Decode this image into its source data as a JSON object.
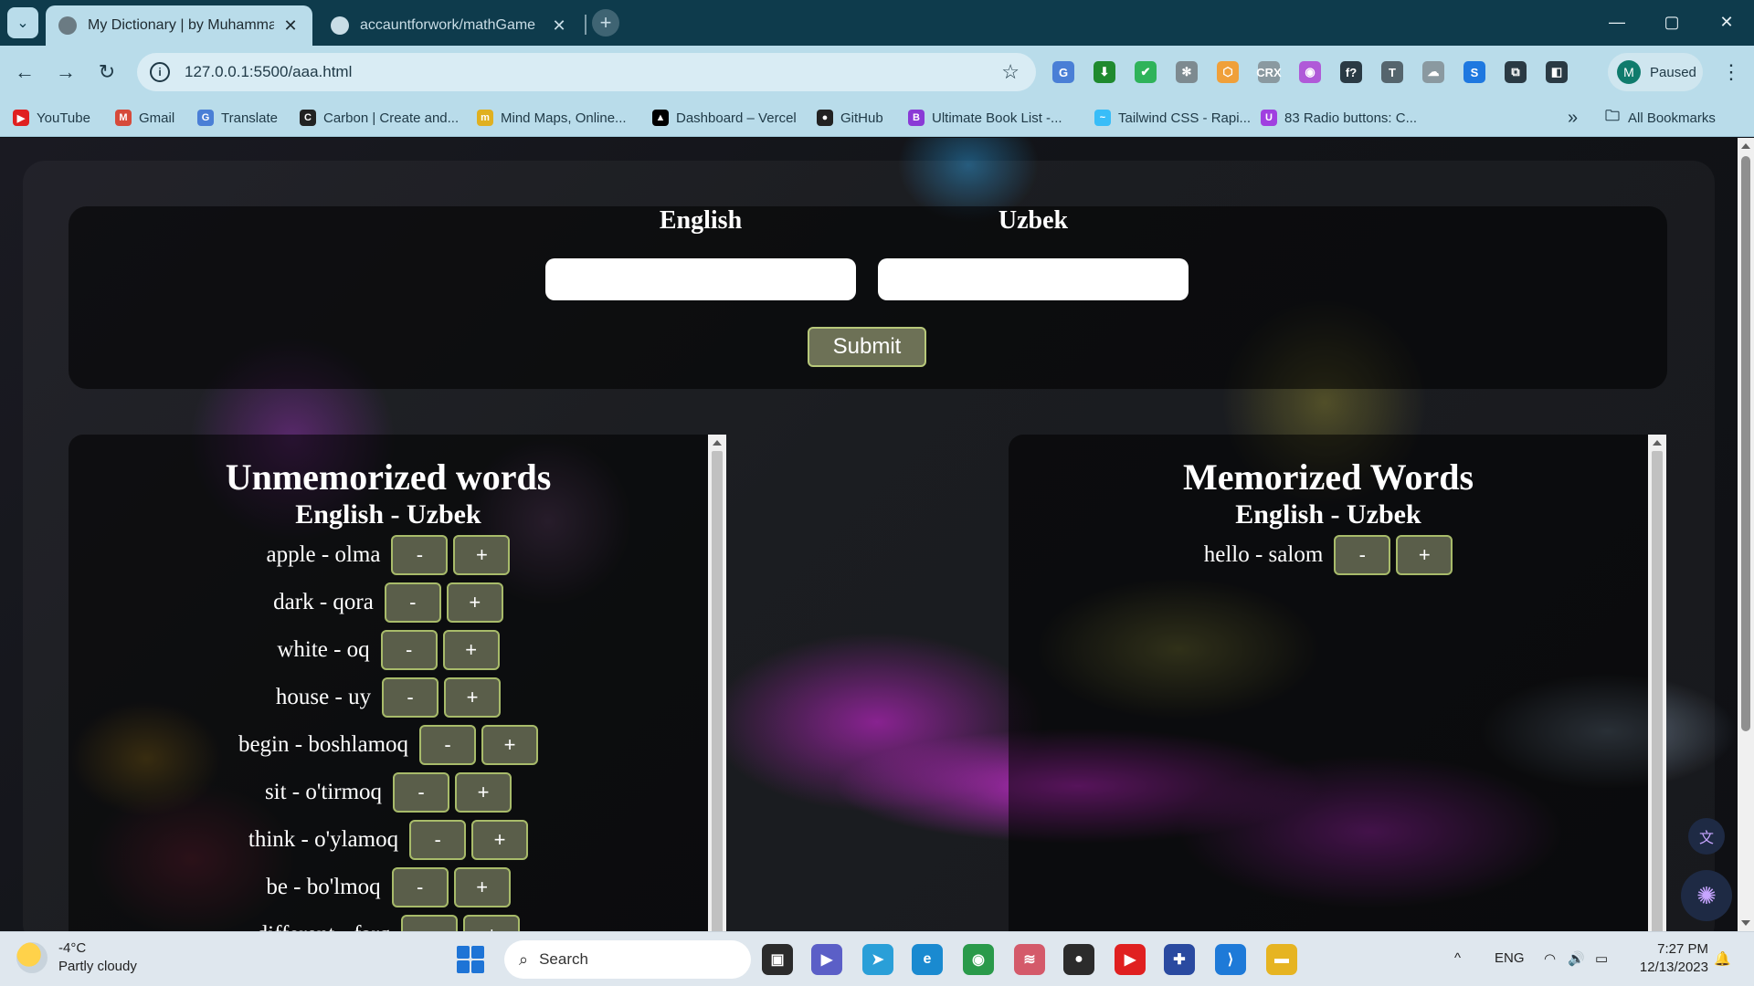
{
  "browser": {
    "tabs": [
      {
        "title": "My Dictionary | by Muhammad",
        "close": "✕"
      },
      {
        "title": "accauntforwork/mathGame",
        "close": "✕"
      }
    ],
    "new_tab": "+",
    "window_controls": {
      "minimize": "—",
      "maximize": "▢",
      "close": "✕"
    },
    "nav": {
      "back": "←",
      "forward": "→",
      "reload": "↻"
    },
    "url": "127.0.0.1:5500/aaa.html",
    "bookmark_star": "☆",
    "profile": {
      "initial": "M",
      "status": "Paused"
    },
    "menu": "⋮",
    "extensions": [
      {
        "name": "google-translate-icon",
        "label": "G",
        "color": "#4a7fd6"
      },
      {
        "name": "download-icon",
        "label": "⬇",
        "color": "#1f8a2e"
      },
      {
        "name": "shield-check-icon",
        "label": "✔",
        "color": "#2fb35a"
      },
      {
        "name": "gear-extension-icon",
        "label": "✻",
        "color": "#7d8a90"
      },
      {
        "name": "hexagon-extension-icon",
        "label": "⬡",
        "color": "#f0a03a"
      },
      {
        "name": "crx-icon",
        "label": "CRX",
        "color": "#8a99a0"
      },
      {
        "name": "color-wheel-icon",
        "label": "◉",
        "color": "#b05ad8"
      },
      {
        "name": "formula-icon",
        "label": "f?",
        "color": "#2a3a44"
      },
      {
        "name": "text-t-icon",
        "label": "T",
        "color": "#55656d"
      },
      {
        "name": "cloud-extension-icon",
        "label": "☁",
        "color": "#8a99a0"
      },
      {
        "name": "shazam-icon",
        "label": "S",
        "color": "#1e78e0"
      },
      {
        "name": "puzzle-extensions-icon",
        "label": "⧉",
        "color": "#2a3a44"
      },
      {
        "name": "side-panel-icon",
        "label": "◧",
        "color": "#2a3a44"
      }
    ],
    "bookmarks": [
      {
        "label": "YouTube",
        "icon": "youtube-icon",
        "glyph": "▶",
        "color": "#e02020"
      },
      {
        "label": "Gmail",
        "icon": "gmail-icon",
        "glyph": "M",
        "color": "#d64a3a"
      },
      {
        "label": "Translate",
        "icon": "translate-icon",
        "glyph": "G",
        "color": "#4a7fd6"
      },
      {
        "label": "Carbon | Create and...",
        "icon": "carbon-icon",
        "glyph": "C",
        "color": "#222222"
      },
      {
        "label": "Mind Maps, Online...",
        "icon": "miro-icon",
        "glyph": "m",
        "color": "#e0b020"
      },
      {
        "label": "Dashboard – Vercel",
        "icon": "vercel-icon",
        "glyph": "▲",
        "color": "#000000"
      },
      {
        "label": "GitHub",
        "icon": "github-icon",
        "glyph": "●",
        "color": "#222222"
      },
      {
        "label": "Ultimate Book List -...",
        "icon": "book-list-icon",
        "glyph": "B",
        "color": "#8a3ad6"
      },
      {
        "label": "Tailwind CSS - Rapi...",
        "icon": "tailwind-icon",
        "glyph": "~",
        "color": "#38bdf8"
      },
      {
        "label": "83 Radio buttons: C...",
        "icon": "uiverse-icon",
        "glyph": "U",
        "color": "#a040e0"
      }
    ],
    "more_bookmarks": "»",
    "all_bookmarks": "All Bookmarks"
  },
  "page": {
    "form": {
      "english_label": "English",
      "uzbek_label": "Uzbek",
      "english_value": "",
      "uzbek_value": "",
      "submit_label": "Submit"
    },
    "unmemorized": {
      "title": "Unmemorized words",
      "subtitle": "English - Uzbek",
      "words": [
        "apple - olma",
        "dark - qora",
        "white - oq",
        "house - uy",
        "begin - boshlamoq",
        "sit - o'tirmoq",
        "think - o'ylamoq",
        "be - bo'lmoq",
        "different - farq"
      ]
    },
    "memorized": {
      "title": "Memorized Words",
      "subtitle": "English - Uzbek",
      "words": [
        "hello - salom"
      ]
    },
    "minus_label": "-",
    "plus_label": "+"
  },
  "taskbar": {
    "weather_temp": "-4°C",
    "weather_desc": "Partly cloudy",
    "search_placeholder": "Search",
    "apps": [
      {
        "name": "task-view-icon",
        "glyph": "▣",
        "color": "#2b2b2b"
      },
      {
        "name": "teams-icon",
        "glyph": "▶",
        "color": "#5b5fc7"
      },
      {
        "name": "telegram-icon",
        "glyph": "➤",
        "color": "#2a9fd8"
      },
      {
        "name": "edge-icon",
        "glyph": "e",
        "color": "#1a8ad0"
      },
      {
        "name": "chrome-icon",
        "glyph": "◉",
        "color": "#2a9a4a"
      },
      {
        "name": "stack-app-icon",
        "glyph": "≋",
        "color": "#d45a6a"
      },
      {
        "name": "obs-icon",
        "glyph": "●",
        "color": "#2b2b2b"
      },
      {
        "name": "youtube-app-icon",
        "glyph": "▶",
        "color": "#e02020"
      },
      {
        "name": "flag-app-icon",
        "glyph": "✚",
        "color": "#2a4aa0"
      },
      {
        "name": "vscode-icon",
        "glyph": "⟩",
        "color": "#1e7ad8"
      },
      {
        "name": "file-explorer-icon",
        "glyph": "▬",
        "color": "#e6b422"
      }
    ],
    "tray": {
      "chevron": "^",
      "language": "ENG",
      "wifi": "◠",
      "volume": "🔊",
      "battery": "▭",
      "notification": "🔔"
    },
    "time": "7:27 PM",
    "date": "12/13/2023"
  }
}
